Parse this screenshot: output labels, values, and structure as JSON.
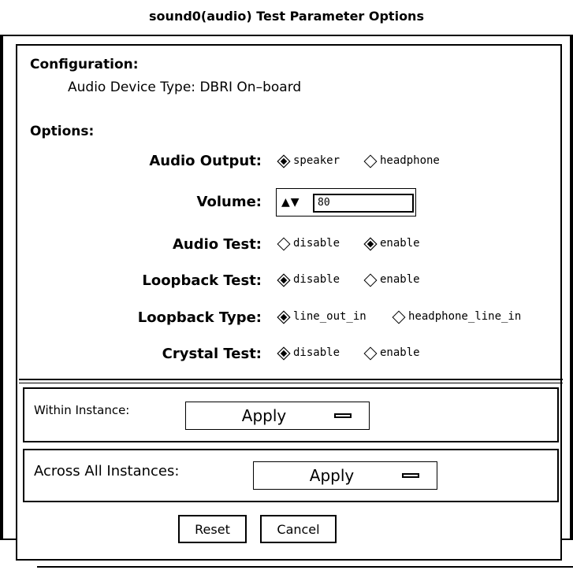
{
  "window": {
    "title": "sound0(audio) Test Parameter Options"
  },
  "configuration": {
    "heading": "Configuration:",
    "device_type": "Audio Device Type: DBRI On–board"
  },
  "options": {
    "heading": "Options:",
    "audio_output": {
      "label": "Audio Output:",
      "choices": [
        "speaker",
        "headphone"
      ],
      "selected": "speaker"
    },
    "volume": {
      "label": "Volume:",
      "value": "80",
      "arrows": "▲▼"
    },
    "audio_test": {
      "label": "Audio Test:",
      "choices": [
        "disable",
        "enable"
      ],
      "selected": "enable"
    },
    "loopback_test": {
      "label": "Loopback Test:",
      "choices": [
        "disable",
        "enable"
      ],
      "selected": "disable"
    },
    "loopback_type": {
      "label": "Loopback Type:",
      "choices": [
        "line_out_in",
        "headphone_line_in"
      ],
      "selected": "line_out_in"
    },
    "crystal_test": {
      "label": "Crystal Test:",
      "choices": [
        "disable",
        "enable"
      ],
      "selected": "disable"
    }
  },
  "within_instance": {
    "label": "Within Instance:",
    "button": "Apply"
  },
  "across_instances": {
    "label": "Across All Instances:",
    "button": "Apply"
  },
  "buttons": {
    "reset": "Reset",
    "cancel": "Cancel"
  }
}
